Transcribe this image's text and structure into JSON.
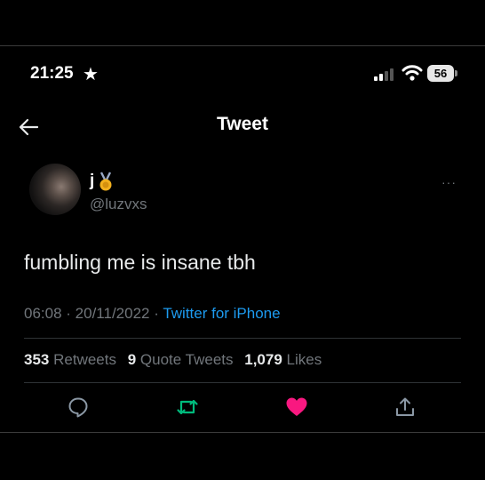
{
  "status_bar": {
    "time": "21:25",
    "star": "★",
    "battery": "56"
  },
  "nav": {
    "title": "Tweet"
  },
  "tweet": {
    "name": "j",
    "handle": "@luzvxs",
    "text": "fumbling me is insane tbh",
    "time": "06:08",
    "date": "20/11/2022",
    "source": "Twitter for iPhone",
    "more": "···"
  },
  "stats": {
    "retweets": "353",
    "retweets_label": "Retweets",
    "quotes": "9",
    "quotes_label": "Quote Tweets",
    "likes": "1,079",
    "likes_label": "Likes"
  },
  "actions": [
    "reply-icon",
    "retweet-icon",
    "like-icon",
    "share-icon"
  ],
  "colors": {
    "background": "#000000",
    "text": "#e7e9ea",
    "secondary_text": "#71767b",
    "link": "#1d9bf0",
    "retweet": "#00ba7c",
    "like": "#f91880"
  }
}
